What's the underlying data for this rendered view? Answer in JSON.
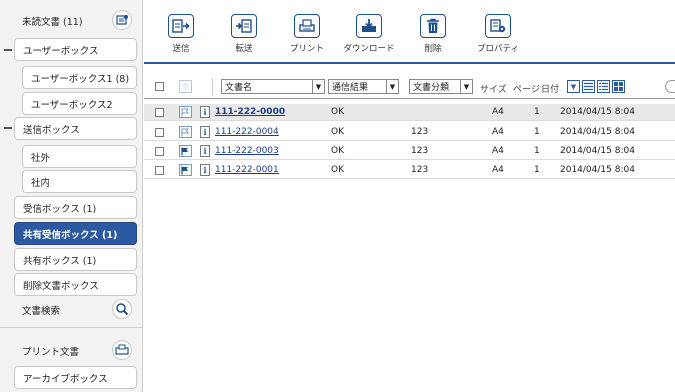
{
  "sidebar": {
    "unread": "未読文書 (11)",
    "user_box": "ユーザーボックス",
    "user_box_1": "ユーザーボックス1 (8)",
    "user_box_2": "ユーザーボックス2",
    "send_box": "送信ボックス",
    "external": "社外",
    "internal": "社内",
    "receive_box": "受信ボックス (1)",
    "shared_receive_box": "共有受信ボックス (1)",
    "shared_box": "共有ボックス (1)",
    "deleted_box": "削除文書ボックス",
    "document_search": "文書検索",
    "print_docs": "プリント文書",
    "archive_box": "アーカイブボックス"
  },
  "toolbar": {
    "send": "送信",
    "forward": "転送",
    "print": "プリント",
    "download": "ダウンロード",
    "delete": "削除",
    "properties": "プロパティ"
  },
  "list_header": {
    "filter_name": "文書名",
    "filter_result": "通信結果",
    "filter_category": "文書分類",
    "size": "サイズ",
    "page": "ページ",
    "date": "日付"
  },
  "rows": [
    {
      "name": "111-222-0000",
      "result": "OK",
      "category": "",
      "size": "A4",
      "pages": "1",
      "date": "2014/04/15 8:04",
      "flag": "outline"
    },
    {
      "name": "111-222-0004",
      "result": "OK",
      "category": "123",
      "size": "A4",
      "pages": "1",
      "date": "2014/04/15 8:04",
      "flag": "outline"
    },
    {
      "name": "111-222-0003",
      "result": "OK",
      "category": "123",
      "size": "A4",
      "pages": "1",
      "date": "2014/04/15 8:04",
      "flag": "filled"
    },
    {
      "name": "111-222-0001",
      "result": "OK",
      "category": "123",
      "size": "A4",
      "pages": "1",
      "date": "2014/04/15 8:04",
      "flag": "filled"
    }
  ],
  "colors": {
    "accent": "#2b5aa3",
    "link": "#1d3d8c"
  }
}
